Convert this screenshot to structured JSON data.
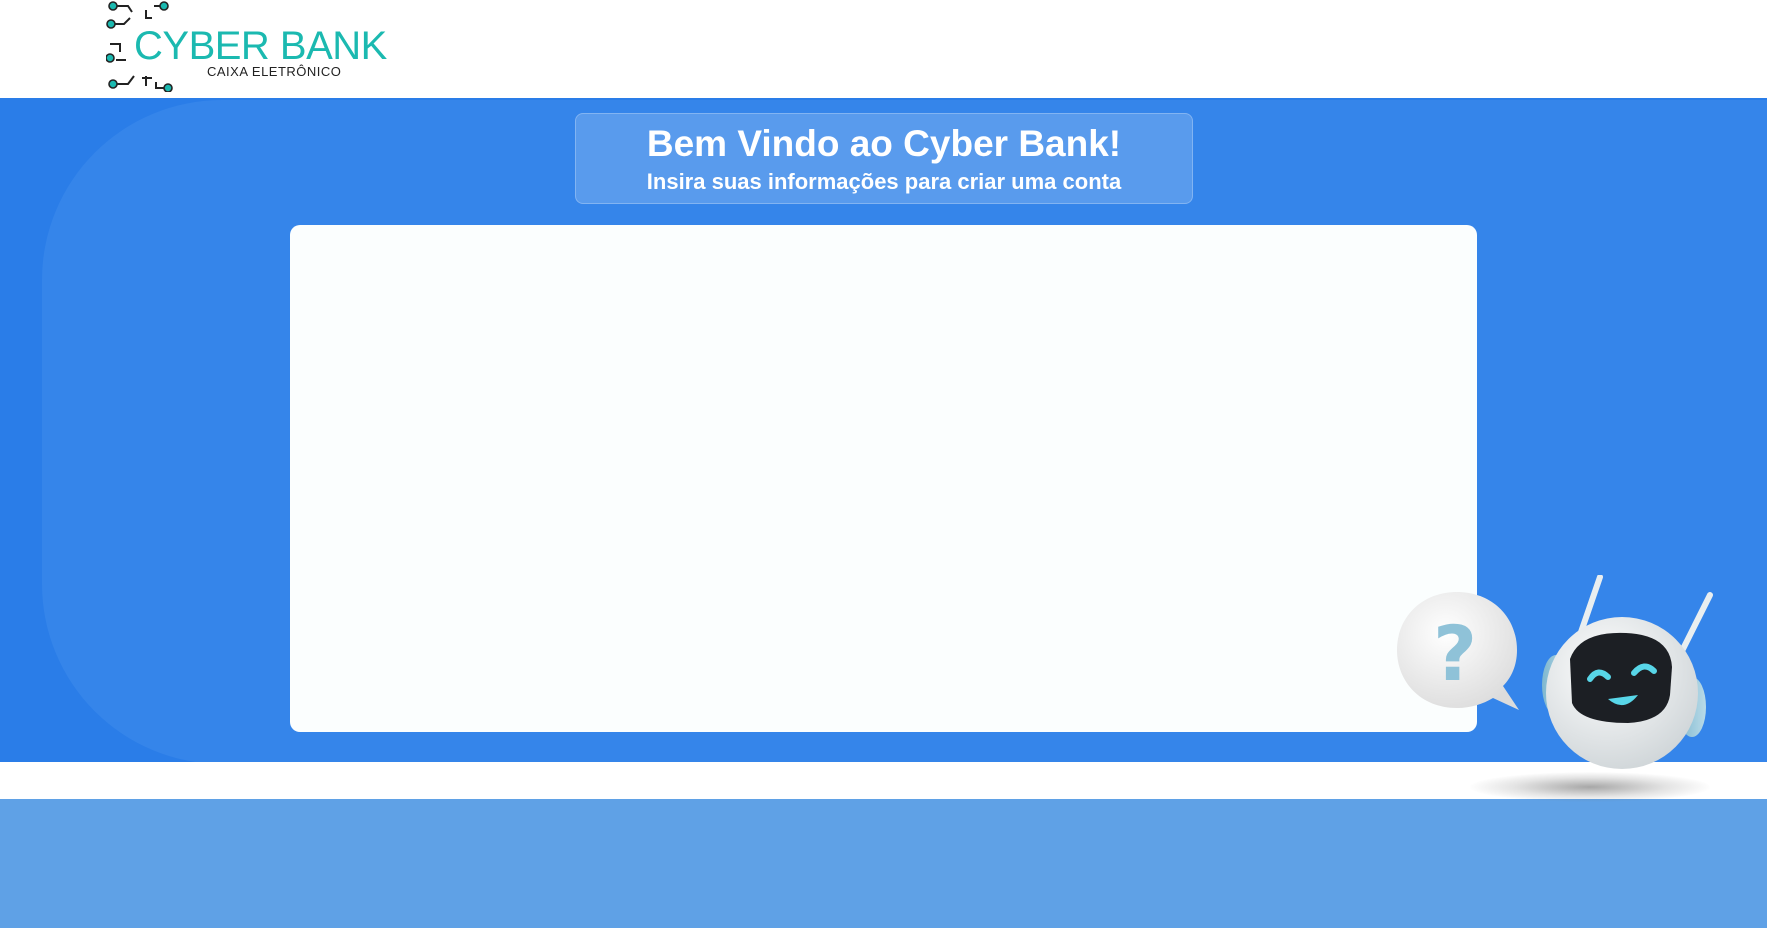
{
  "header": {
    "logo_title": "CYBER BANK",
    "logo_subtitle": "CAIXA ELETRÔNICO"
  },
  "welcome": {
    "title": "Bem Vindo ao Cyber Bank!",
    "subtitle": "Insira suas informações para criar uma conta"
  },
  "assistant": {
    "bubble_symbol": "?",
    "icon": "robot-icon"
  },
  "colors": {
    "primary_blue": "#2a7de8",
    "footer_blue": "#5fa1e6",
    "logo_teal": "#1bb9b0"
  }
}
